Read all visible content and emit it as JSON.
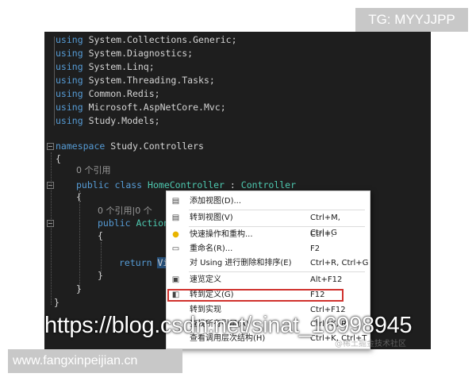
{
  "editor": {
    "using_keyword": "using",
    "usings": [
      "System.Collections.Generic;",
      "System.Diagnostics;",
      "System.Linq;",
      "System.Threading.Tasks;",
      "Common.Redis;",
      "Microsoft.AspNetCore.Mvc;",
      "Study.Models;"
    ],
    "namespace_keyword": "namespace",
    "namespace_name": "Study.Controllers",
    "open_brace": "{",
    "close_brace": "}",
    "ref_count_1": "0 个引用",
    "class_public": "public",
    "class_keyword": "class",
    "class_name": "HomeController",
    "colon": ":",
    "base_class": "Controller",
    "ref_count_2": "0 个引用|0 个",
    "method_public": "public",
    "method_name": "Action",
    "return_keyword": "return",
    "return_value": "Vi"
  },
  "context_menu": {
    "items": [
      {
        "icon": "add-view-icon",
        "label": "添加视图(D)...",
        "shortcut": ""
      },
      {
        "icon": "go-to-view-icon",
        "label": "转到视图(V)",
        "shortcut": "Ctrl+M, Ctrl+G"
      },
      {
        "icon": "lightbulb-icon",
        "label": "快速操作和重构...",
        "shortcut": "Ctrl+."
      },
      {
        "icon": "rename-icon",
        "label": "重命名(R)...",
        "shortcut": "F2"
      },
      {
        "icon": "",
        "label": "对 Using 进行删除和排序(E)",
        "shortcut": "Ctrl+R, Ctrl+G"
      },
      {
        "icon": "peek-definition-icon",
        "label": "速览定义",
        "shortcut": "Alt+F12"
      },
      {
        "icon": "go-to-definition-icon",
        "label": "转到定义(G)",
        "shortcut": "F12"
      },
      {
        "icon": "",
        "label": "转到实现",
        "shortcut": "Ctrl+F12"
      },
      {
        "icon": "",
        "label": "查找所有引用(A)",
        "shortcut": "Ctrl+K, R"
      },
      {
        "icon": "",
        "label": "查看调用层次结构(H)",
        "shortcut": "Ctrl+K, Ctrl+T"
      }
    ],
    "highlighted_item": "转到定义(G)"
  },
  "watermarks": {
    "tg": "TG: MYYJJPP",
    "url": "https://blog.csdn.net/sinat_16998945",
    "community": "@稀土掘金技术社区",
    "site": "www.fangxinpeijian.cn"
  },
  "colors": {
    "editor_bg": "#1e1e1e",
    "keyword": "#569cd6",
    "type": "#4ec9b0",
    "highlight_border": "#d0312d"
  }
}
